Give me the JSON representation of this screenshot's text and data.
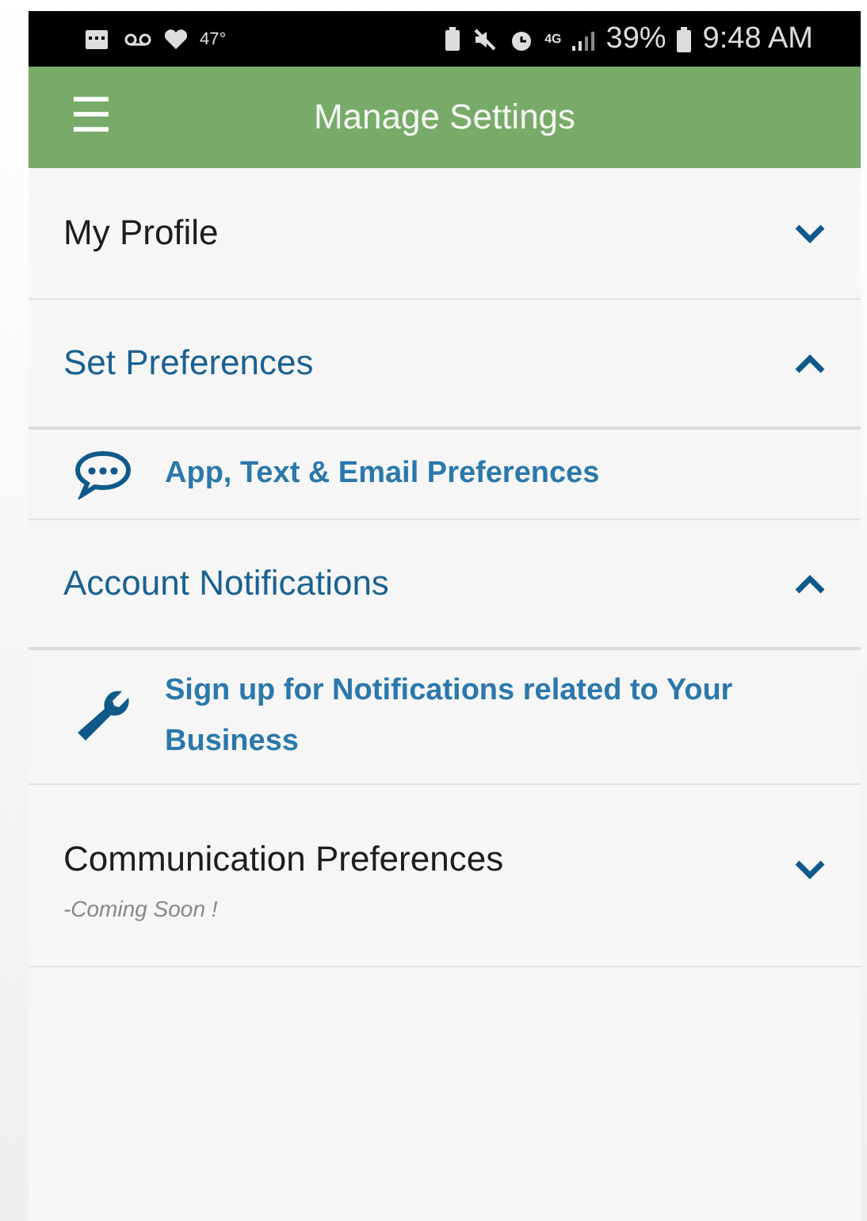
{
  "status_bar": {
    "temperature": "47°",
    "network": "4G",
    "battery": "39%",
    "time": "9:48 AM"
  },
  "header": {
    "menu_icon": "☰",
    "title": "Manage Settings"
  },
  "sections": [
    {
      "title": "My Profile",
      "expanded": false
    },
    {
      "title": "Set Preferences",
      "expanded": true,
      "items": [
        {
          "kind": "chat",
          "label": "App, Text & Email Preferences"
        }
      ]
    },
    {
      "title": "Account Notifications",
      "expanded": true,
      "items": [
        {
          "kind": "wrench",
          "label": "Sign up for Notifications related to Your Business"
        }
      ]
    },
    {
      "title": "Communication Preferences",
      "expanded": false,
      "note": "-Coming Soon !"
    }
  ]
}
